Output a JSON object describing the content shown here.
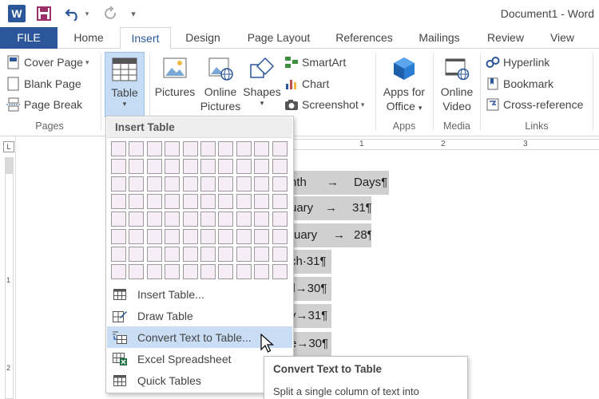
{
  "window": {
    "title": "Document1 - Word"
  },
  "qat": {
    "logo_letter": "W",
    "save": "save-icon",
    "undo": "undo-icon",
    "redo": "redo-icon",
    "customize": "customize-qat-icon"
  },
  "tabs": [
    "FILE",
    "Home",
    "Insert",
    "Design",
    "Page Layout",
    "References",
    "Mailings",
    "Review",
    "View"
  ],
  "active_tab": "Insert",
  "ribbon": {
    "pages": {
      "label": "Pages",
      "cover_page": "Cover Page",
      "blank_page": "Blank Page",
      "page_break": "Page Break"
    },
    "table": {
      "label": "Table"
    },
    "illustrations": {
      "pictures": "Pictures",
      "online_pictures_1": "Online",
      "online_pictures_2": "Pictures",
      "shapes": "Shapes",
      "smartart": "SmartArt",
      "chart": "Chart",
      "screenshot": "Screenshot"
    },
    "apps": {
      "label": "Apps",
      "apps_for_office_1": "Apps for",
      "apps_for_office_2": "Office"
    },
    "media": {
      "label": "Media",
      "online_video_1": "Online",
      "online_video_2": "Video"
    },
    "links": {
      "label": "Links",
      "hyperlink": "Hyperlink",
      "bookmark": "Bookmark",
      "cross_reference": "Cross-reference"
    }
  },
  "ruler": {
    "top_numbers": [
      "1",
      "2",
      "3"
    ],
    "left_numbers": [
      "1",
      "2"
    ]
  },
  "document": {
    "rows": [
      {
        "a": "nth",
        "arrow": "→",
        "b": "Days¶"
      },
      {
        "a": "uary",
        "arrow": "→",
        "b": "31¶"
      },
      {
        "a": "ruary",
        "arrow": "→",
        "b": "28¶"
      },
      {
        "a": "ch·31¶",
        "arrow": "",
        "b": ""
      },
      {
        "a": "il→30¶",
        "arrow": "",
        "b": ""
      },
      {
        "a": "y→31¶",
        "arrow": "",
        "b": ""
      },
      {
        "a": "e→30¶",
        "arrow": "",
        "b": ""
      }
    ]
  },
  "dropdown": {
    "header": "Insert Table",
    "grid": {
      "cols": 10,
      "rows": 8
    },
    "items": [
      {
        "label": "Insert Table...",
        "icon": "insert-table-icon"
      },
      {
        "label": "Draw Table",
        "icon": "draw-table-icon"
      },
      {
        "label": "Convert Text to Table...",
        "icon": "convert-text-to-table-icon"
      },
      {
        "label": "Excel Spreadsheet",
        "icon": "excel-spreadsheet-icon"
      },
      {
        "label": "Quick Tables",
        "icon": "quick-tables-icon"
      }
    ]
  },
  "tooltip": {
    "title": "Convert Text to Table",
    "body": "Split a single column of text into"
  },
  "colors": {
    "word_blue": "#2b579a",
    "menu_hover": "#c9def5",
    "grid_cell": "#f6edf6",
    "selection_grey": "#d0d0d0"
  }
}
